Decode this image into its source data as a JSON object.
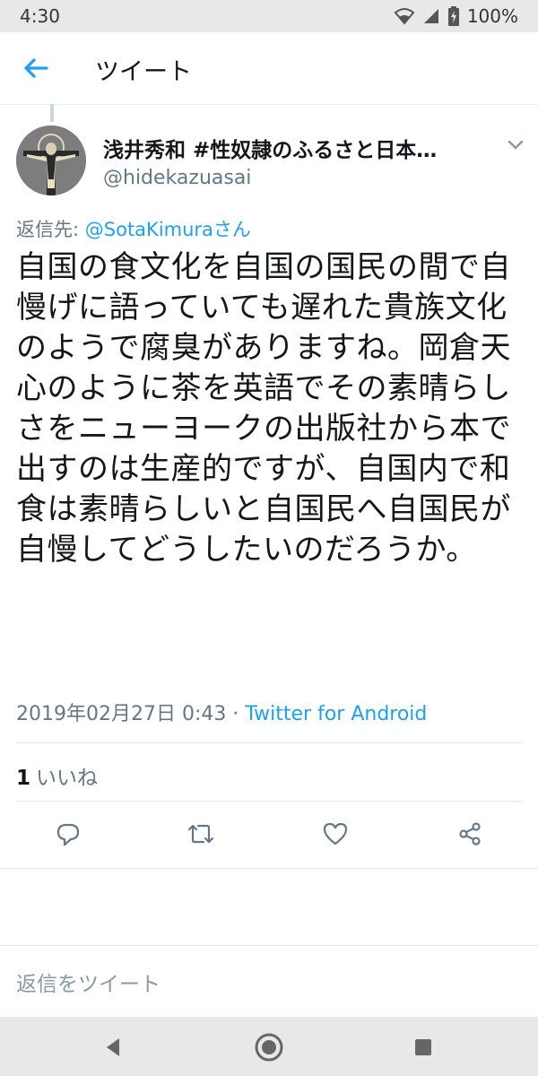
{
  "status_bar": {
    "time": "4:30",
    "battery": "100%",
    "icons": [
      "wifi-icon",
      "signal-icon",
      "battery-charging-icon"
    ]
  },
  "app_bar": {
    "title": "ツイート",
    "back_icon": "arrow-left-icon"
  },
  "tweet": {
    "author_name": "浅井秀和 #性奴隷のふるさと日本…",
    "author_handle": "@hidekazuasai",
    "reply_prefix": "返信先: ",
    "reply_to": "@SotaKimuraさん",
    "text": "自国の食文化を自国の国民の間で自慢げに語っていても遅れた貴族文化のようで腐臭がありますね。岡倉天心のように茶を英語でその素晴らしさをニューヨークの出版社から本で出すのは生産的ですが、自国内で和食は素晴らしいと自国民へ自国民が自慢してどうしたいのだろうか。",
    "timestamp": "2019年02月27日 0:43",
    "separator": " · ",
    "source": "Twitter for Android",
    "like_count": "1",
    "like_label": "いいね"
  },
  "actions": {
    "icons": [
      "reply-icon",
      "retweet-icon",
      "like-icon",
      "share-icon"
    ]
  },
  "reply_box": {
    "placeholder": "返信をツイート"
  },
  "nav_bar": {
    "icons": [
      "back-triangle-icon",
      "home-circle-icon",
      "recents-square-icon"
    ]
  },
  "colors": {
    "accent": "#1da1f2",
    "secondary_text": "#657786",
    "primary_text": "#14171a",
    "system_bar": "#e8e8e8"
  }
}
